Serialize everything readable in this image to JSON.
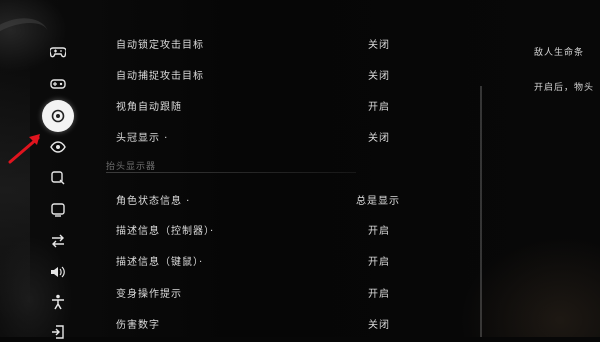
{
  "sidebar": {
    "icons": [
      {
        "name": "gamepad-icon",
        "glyph": "🎮"
      },
      {
        "name": "controller-settings-icon",
        "glyph": "⌘"
      },
      {
        "name": "target-icon",
        "glyph": "◉"
      },
      {
        "name": "eye-icon",
        "glyph": "◎"
      },
      {
        "name": "search-icon",
        "glyph": "⌕"
      },
      {
        "name": "display-icon",
        "glyph": "▣"
      },
      {
        "name": "swap-icon",
        "glyph": "⇄"
      },
      {
        "name": "sound-icon",
        "glyph": "🔊"
      },
      {
        "name": "accessibility-icon",
        "glyph": "✦"
      },
      {
        "name": "exit-icon",
        "glyph": "⏏"
      }
    ]
  },
  "settings": {
    "rows": [
      {
        "label": "自动锁定攻击目标",
        "value": "关闭"
      },
      {
        "label": "自动捕捉攻击目标",
        "value": "关闭"
      },
      {
        "label": "视角自动跟随",
        "value": "开启"
      },
      {
        "label": "头冠显示 ·",
        "value": "关闭"
      }
    ],
    "section_title": "抬头显示器",
    "hud_rows": [
      {
        "label": "角色状态信息 ·",
        "value": "总是显示"
      },
      {
        "label": "描述信息（控制器）·",
        "value": "开启"
      },
      {
        "label": "描述信息（键鼠）·",
        "value": "开启"
      },
      {
        "label": "变身操作提示",
        "value": "开启"
      },
      {
        "label": "伤害数字",
        "value": "关闭"
      }
    ]
  },
  "description": {
    "line1": "敌人生命条",
    "line2": "开启后，物头"
  },
  "colors": {
    "background": "#070707",
    "text": "#dcdcdc",
    "muted": "#6e6e6e",
    "arrow": "#e0141e",
    "active_icon_bg": "#f3f3f3"
  }
}
